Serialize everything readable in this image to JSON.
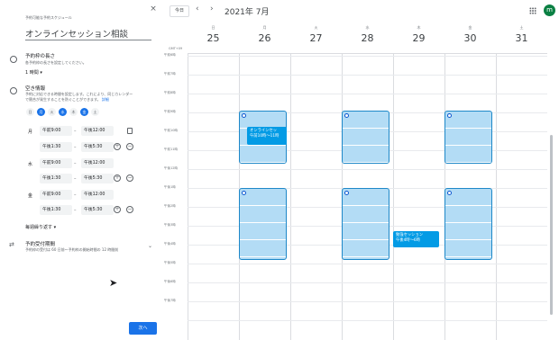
{
  "panel": {
    "subtitle": "予約可能な予約スケジュール",
    "title": "オンラインセッション相談",
    "duration": {
      "heading": "予約枠の長さ",
      "desc": "各予約枠の長さを設定してください。",
      "value": "1 時間"
    },
    "availability": {
      "heading": "空き情報",
      "desc1": "予約に対応できる時間を設定します。これにより、同じカレンダー",
      "desc2": "で競合が発生することを防ぐことができます。",
      "link": "詳細",
      "days": [
        "日",
        "月",
        "火",
        "水",
        "木",
        "金",
        "土"
      ],
      "selected_days": [
        "月",
        "水",
        "金"
      ],
      "rows": [
        {
          "day": "月",
          "from": "午前9:00",
          "to": "午後12:00"
        },
        {
          "day": "",
          "from": "午後1:30",
          "to": "午後5:30"
        },
        {
          "day": "水",
          "from": "午前9:00",
          "to": "午後12:00"
        },
        {
          "day": "",
          "from": "午後1:30",
          "to": "午後5:30"
        },
        {
          "day": "金",
          "from": "午前9:00",
          "to": "午後12:00"
        },
        {
          "day": "",
          "from": "午後1:30",
          "to": "午後5:30"
        }
      ],
      "separator": "–",
      "repeat": "毎週繰り返す"
    },
    "booking_period": {
      "heading": "予約受付期間",
      "desc": "予約枠の受付は 60 日前〜予約枠の開始時間の 12 時間前"
    },
    "next_label": "次へ",
    "close": "×"
  },
  "calendar": {
    "today": "今日",
    "prev": "‹",
    "next": "›",
    "month": "2021年 7月",
    "avatar": "m",
    "timezone": "GMT+09",
    "days": [
      {
        "name": "日",
        "num": "25"
      },
      {
        "name": "月",
        "num": "26"
      },
      {
        "name": "火",
        "num": "27"
      },
      {
        "name": "水",
        "num": "28"
      },
      {
        "name": "木",
        "num": "29"
      },
      {
        "name": "金",
        "num": "30"
      },
      {
        "name": "土",
        "num": "31"
      }
    ],
    "hours": [
      "午前6時",
      "午前7時",
      "午前8時",
      "午前9時",
      "午前10時",
      "午前11時",
      "午後12時",
      "午後1時",
      "午後2時",
      "午後3時",
      "午後4時",
      "午後5時",
      "午後6時",
      "午後7時"
    ],
    "events": [
      {
        "title": "オンラインセッ",
        "time": "午前10時〜11時"
      },
      {
        "title": "勉強セッション",
        "time": "午後4時〜6時"
      }
    ],
    "colors": {
      "slot": "#b3dcf5",
      "event": "#039be5",
      "accent": "#1a73e8"
    }
  }
}
